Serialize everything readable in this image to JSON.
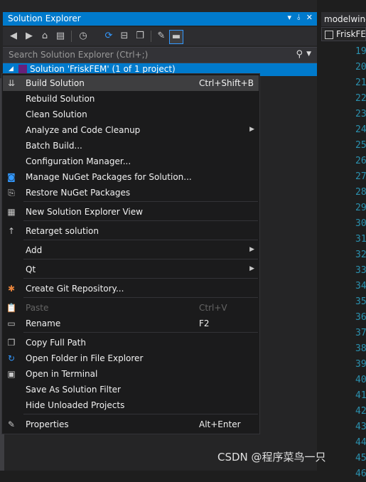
{
  "solution_explorer": {
    "title": "Solution Explorer",
    "title_buttons": [
      "▾",
      "⫰",
      "✕"
    ],
    "search_placeholder": "Search Solution Explorer (Ctrl+;)",
    "selected_item": "Solution 'FriskFEM' (1 of 1 project)"
  },
  "editor": {
    "tab_label": "modelwindow",
    "nav_label": "FriskFEM",
    "line_numbers": [
      "19",
      "20",
      "21",
      "22",
      "23",
      "24",
      "25",
      "26",
      "27",
      "28",
      "29",
      "30",
      "31",
      "32",
      "33",
      "34",
      "35",
      "36",
      "37",
      "38",
      "39",
      "40",
      "41",
      "42",
      "43",
      "44",
      "45",
      "46"
    ]
  },
  "context_menu": {
    "items": [
      {
        "label": "Build Solution",
        "shortcut": "Ctrl+Shift+B",
        "icon": "build-icon"
      },
      {
        "label": "Rebuild Solution",
        "shortcut": "",
        "icon": ""
      },
      {
        "label": "Clean Solution",
        "shortcut": "",
        "icon": ""
      },
      {
        "label": "Analyze and Code Cleanup",
        "shortcut": "",
        "icon": "",
        "submenu": true
      },
      {
        "label": "Batch Build...",
        "shortcut": "",
        "icon": ""
      },
      {
        "label": "Configuration Manager...",
        "shortcut": "",
        "icon": ""
      },
      {
        "label": "Manage NuGet Packages for Solution...",
        "shortcut": "",
        "icon": "nuget-icon"
      },
      {
        "label": "Restore NuGet Packages",
        "shortcut": "",
        "icon": "restore-icon"
      },
      {
        "label": "New Solution Explorer View",
        "shortcut": "",
        "icon": "new-view-icon"
      },
      {
        "label": "Retarget solution",
        "shortcut": "",
        "icon": "arrow-up-icon"
      },
      {
        "label": "Add",
        "shortcut": "",
        "icon": "",
        "submenu": true
      },
      {
        "label": "Qt",
        "shortcut": "",
        "icon": "",
        "submenu": true
      },
      {
        "label": "Create Git Repository...",
        "shortcut": "",
        "icon": "git-icon"
      },
      {
        "label": "Paste",
        "shortcut": "Ctrl+V",
        "icon": "paste-icon",
        "disabled": true
      },
      {
        "label": "Rename",
        "shortcut": "F2",
        "icon": "rename-icon"
      },
      {
        "label": "Copy Full Path",
        "shortcut": "",
        "icon": "copy-icon"
      },
      {
        "label": "Open Folder in File Explorer",
        "shortcut": "",
        "icon": "refresh-folder-icon"
      },
      {
        "label": "Open in Terminal",
        "shortcut": "",
        "icon": "terminal-icon"
      },
      {
        "label": "Save As Solution Filter",
        "shortcut": "",
        "icon": ""
      },
      {
        "label": "Hide Unloaded Projects",
        "shortcut": "",
        "icon": ""
      },
      {
        "label": "Properties",
        "shortcut": "Alt+Enter",
        "icon": "wrench-icon"
      }
    ]
  },
  "watermark": "CSDN @程序菜鸟一只",
  "colors": {
    "accent": "#007acc",
    "menu_bg": "#1b1b1c",
    "line_number": "#2b91af"
  }
}
